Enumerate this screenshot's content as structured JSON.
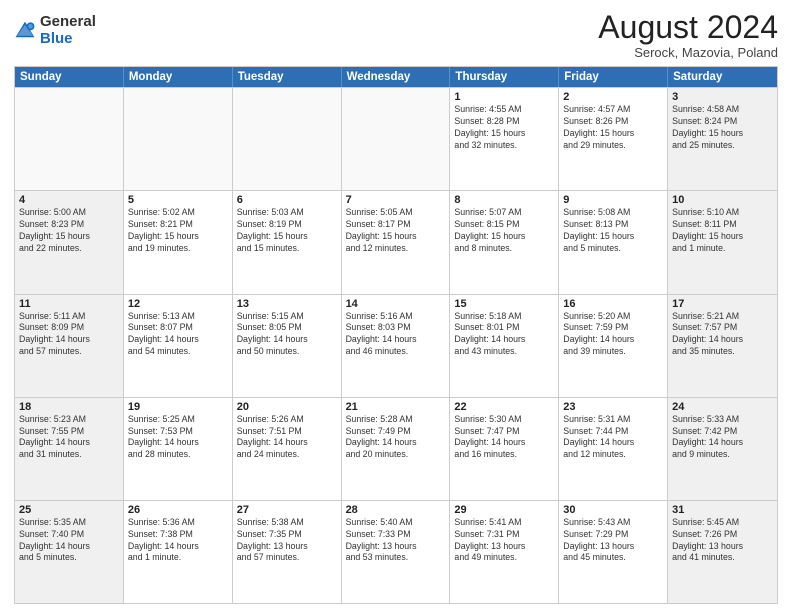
{
  "header": {
    "logo": {
      "line1": "General",
      "line2": "Blue"
    },
    "title": "August 2024",
    "subtitle": "Serock, Mazovia, Poland"
  },
  "weekdays": [
    "Sunday",
    "Monday",
    "Tuesday",
    "Wednesday",
    "Thursday",
    "Friday",
    "Saturday"
  ],
  "rows": [
    [
      {
        "day": "",
        "info": ""
      },
      {
        "day": "",
        "info": ""
      },
      {
        "day": "",
        "info": ""
      },
      {
        "day": "",
        "info": ""
      },
      {
        "day": "1",
        "info": "Sunrise: 4:55 AM\nSunset: 8:28 PM\nDaylight: 15 hours\nand 32 minutes."
      },
      {
        "day": "2",
        "info": "Sunrise: 4:57 AM\nSunset: 8:26 PM\nDaylight: 15 hours\nand 29 minutes."
      },
      {
        "day": "3",
        "info": "Sunrise: 4:58 AM\nSunset: 8:24 PM\nDaylight: 15 hours\nand 25 minutes."
      }
    ],
    [
      {
        "day": "4",
        "info": "Sunrise: 5:00 AM\nSunset: 8:23 PM\nDaylight: 15 hours\nand 22 minutes."
      },
      {
        "day": "5",
        "info": "Sunrise: 5:02 AM\nSunset: 8:21 PM\nDaylight: 15 hours\nand 19 minutes."
      },
      {
        "day": "6",
        "info": "Sunrise: 5:03 AM\nSunset: 8:19 PM\nDaylight: 15 hours\nand 15 minutes."
      },
      {
        "day": "7",
        "info": "Sunrise: 5:05 AM\nSunset: 8:17 PM\nDaylight: 15 hours\nand 12 minutes."
      },
      {
        "day": "8",
        "info": "Sunrise: 5:07 AM\nSunset: 8:15 PM\nDaylight: 15 hours\nand 8 minutes."
      },
      {
        "day": "9",
        "info": "Sunrise: 5:08 AM\nSunset: 8:13 PM\nDaylight: 15 hours\nand 5 minutes."
      },
      {
        "day": "10",
        "info": "Sunrise: 5:10 AM\nSunset: 8:11 PM\nDaylight: 15 hours\nand 1 minute."
      }
    ],
    [
      {
        "day": "11",
        "info": "Sunrise: 5:11 AM\nSunset: 8:09 PM\nDaylight: 14 hours\nand 57 minutes."
      },
      {
        "day": "12",
        "info": "Sunrise: 5:13 AM\nSunset: 8:07 PM\nDaylight: 14 hours\nand 54 minutes."
      },
      {
        "day": "13",
        "info": "Sunrise: 5:15 AM\nSunset: 8:05 PM\nDaylight: 14 hours\nand 50 minutes."
      },
      {
        "day": "14",
        "info": "Sunrise: 5:16 AM\nSunset: 8:03 PM\nDaylight: 14 hours\nand 46 minutes."
      },
      {
        "day": "15",
        "info": "Sunrise: 5:18 AM\nSunset: 8:01 PM\nDaylight: 14 hours\nand 43 minutes."
      },
      {
        "day": "16",
        "info": "Sunrise: 5:20 AM\nSunset: 7:59 PM\nDaylight: 14 hours\nand 39 minutes."
      },
      {
        "day": "17",
        "info": "Sunrise: 5:21 AM\nSunset: 7:57 PM\nDaylight: 14 hours\nand 35 minutes."
      }
    ],
    [
      {
        "day": "18",
        "info": "Sunrise: 5:23 AM\nSunset: 7:55 PM\nDaylight: 14 hours\nand 31 minutes."
      },
      {
        "day": "19",
        "info": "Sunrise: 5:25 AM\nSunset: 7:53 PM\nDaylight: 14 hours\nand 28 minutes."
      },
      {
        "day": "20",
        "info": "Sunrise: 5:26 AM\nSunset: 7:51 PM\nDaylight: 14 hours\nand 24 minutes."
      },
      {
        "day": "21",
        "info": "Sunrise: 5:28 AM\nSunset: 7:49 PM\nDaylight: 14 hours\nand 20 minutes."
      },
      {
        "day": "22",
        "info": "Sunrise: 5:30 AM\nSunset: 7:47 PM\nDaylight: 14 hours\nand 16 minutes."
      },
      {
        "day": "23",
        "info": "Sunrise: 5:31 AM\nSunset: 7:44 PM\nDaylight: 14 hours\nand 12 minutes."
      },
      {
        "day": "24",
        "info": "Sunrise: 5:33 AM\nSunset: 7:42 PM\nDaylight: 14 hours\nand 9 minutes."
      }
    ],
    [
      {
        "day": "25",
        "info": "Sunrise: 5:35 AM\nSunset: 7:40 PM\nDaylight: 14 hours\nand 5 minutes."
      },
      {
        "day": "26",
        "info": "Sunrise: 5:36 AM\nSunset: 7:38 PM\nDaylight: 14 hours\nand 1 minute."
      },
      {
        "day": "27",
        "info": "Sunrise: 5:38 AM\nSunset: 7:35 PM\nDaylight: 13 hours\nand 57 minutes."
      },
      {
        "day": "28",
        "info": "Sunrise: 5:40 AM\nSunset: 7:33 PM\nDaylight: 13 hours\nand 53 minutes."
      },
      {
        "day": "29",
        "info": "Sunrise: 5:41 AM\nSunset: 7:31 PM\nDaylight: 13 hours\nand 49 minutes."
      },
      {
        "day": "30",
        "info": "Sunrise: 5:43 AM\nSunset: 7:29 PM\nDaylight: 13 hours\nand 45 minutes."
      },
      {
        "day": "31",
        "info": "Sunrise: 5:45 AM\nSunset: 7:26 PM\nDaylight: 13 hours\nand 41 minutes."
      }
    ]
  ]
}
